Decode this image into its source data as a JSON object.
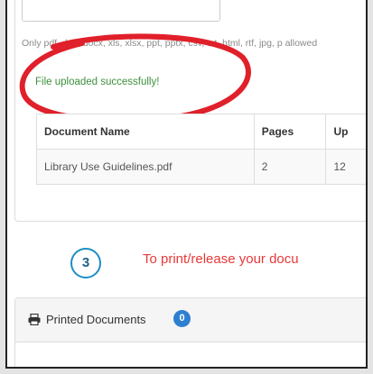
{
  "upload": {
    "allowed_types_note": "Only pdf, doc, docx, xls, xlsx, ppt, pptx, csv, txt, html, rtf, jpg, p allowed",
    "success_bullet": "•",
    "success_message": "File uploaded successfully!"
  },
  "documents_table": {
    "headers": [
      "Document Name",
      "Pages",
      "Up"
    ],
    "rows": [
      {
        "name": "Library Use Guidelines.pdf",
        "pages": "2",
        "uploaded": "12"
      }
    ]
  },
  "step3": {
    "number": "3",
    "text": "To print/release your docu"
  },
  "printed_documents": {
    "label": "Printed Documents",
    "count": "0",
    "icon": "printer-icon"
  },
  "colors": {
    "success": "#3c8f3c",
    "step_text": "#e83838",
    "step_circle": "#1e8ec4",
    "badge": "#2f7fd1",
    "annotation": "#e0202a"
  }
}
